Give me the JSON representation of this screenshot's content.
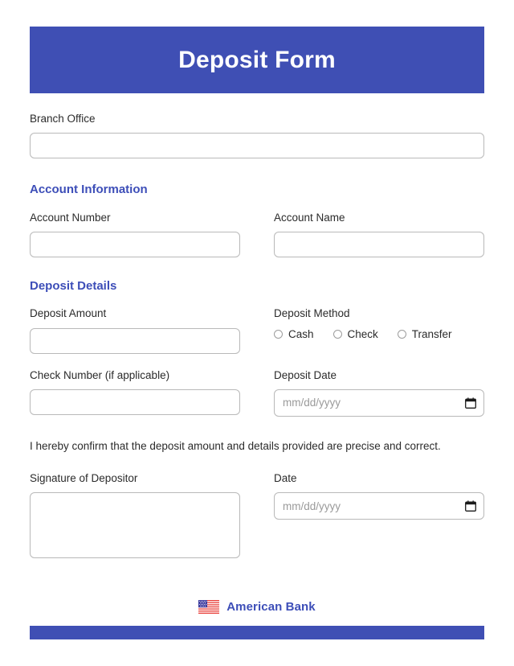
{
  "header": {
    "title": "Deposit Form",
    "bar_color": "#3f4fb4"
  },
  "branch": {
    "label": "Branch Office",
    "value": "",
    "placeholder": ""
  },
  "account_section": {
    "heading": "Account Information",
    "heading_color": "#3d4eb8",
    "account_number": {
      "label": "Account Number",
      "value": "",
      "placeholder": ""
    },
    "account_name": {
      "label": "Account Name",
      "value": "",
      "placeholder": ""
    }
  },
  "deposit_section": {
    "heading": "Deposit Details",
    "deposit_amount": {
      "label": "Deposit Amount",
      "value": "",
      "placeholder": ""
    },
    "deposit_method": {
      "label": "Deposit Method",
      "options": [
        {
          "label": "Cash",
          "selected": false
        },
        {
          "label": "Check",
          "selected": false
        },
        {
          "label": "Transfer",
          "selected": false
        }
      ]
    },
    "check_number": {
      "label": "Check Number (if applicable)",
      "value": "",
      "placeholder": ""
    },
    "deposit_date": {
      "label": "Deposit Date",
      "value": "",
      "placeholder": "mm/dd/yyyy",
      "icon": "calendar-icon"
    }
  },
  "statement": {
    "text": "I hereby confirm that the deposit amount and details provided are precise and correct."
  },
  "signature_section": {
    "signature": {
      "label": "Signature of Depositor",
      "value": ""
    },
    "date": {
      "label": "Date",
      "value": "",
      "placeholder": "mm/dd/yyyy",
      "icon": "calendar-icon"
    }
  },
  "footer": {
    "flag_icon": "us-flag-icon",
    "brand_name": "American Bank",
    "bar_color": "#3f4fb4"
  }
}
